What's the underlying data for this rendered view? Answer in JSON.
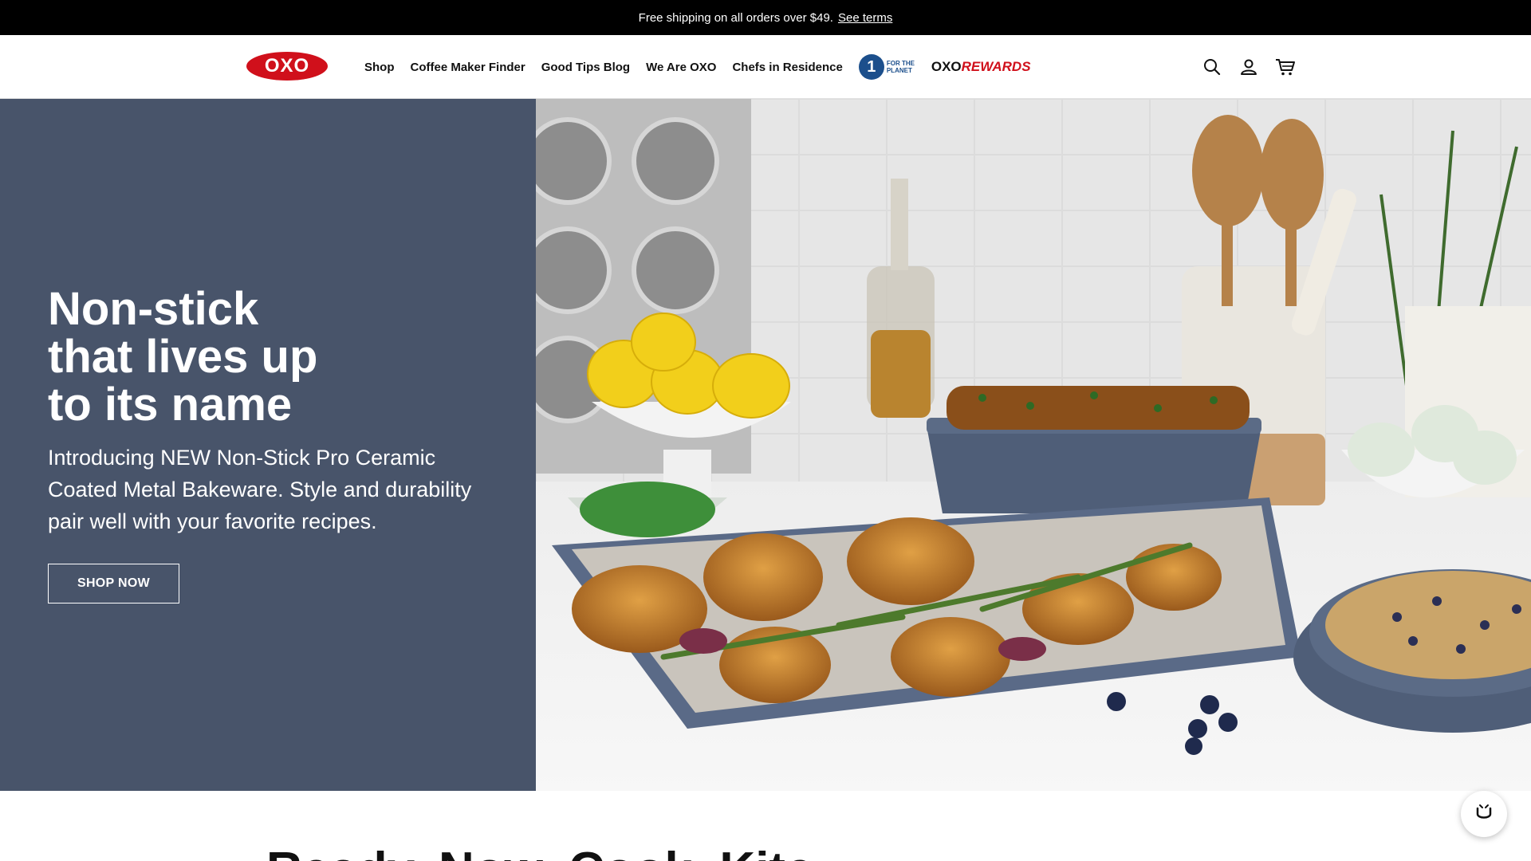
{
  "announcement": {
    "text": "Free shipping on all orders over $49.",
    "terms_link": "See terms"
  },
  "header": {
    "logo_text": "OXO",
    "nav": [
      {
        "label": "Shop"
      },
      {
        "label": "Coffee Maker Finder"
      },
      {
        "label": "Good Tips Blog"
      },
      {
        "label": "We Are OXO"
      },
      {
        "label": "Chefs in Residence"
      }
    ],
    "planet_badge": {
      "number": "1",
      "text": "FOR THE PLANET"
    },
    "rewards": {
      "brand": "OXO",
      "label": "REWARDS"
    },
    "icons": [
      "search-icon",
      "account-icon",
      "cart-icon"
    ]
  },
  "hero": {
    "title": "Non-stick\nthat lives up\nto its name",
    "subtitle": "Introducing NEW Non-Stick Pro Ceramic Coated Metal Bakeware. Style and durability pair well with your favorite recipes.",
    "cta": "SHOP NOW",
    "panel_color": "#48546a"
  },
  "below": {
    "heading": "Ready. Now. Cook. Kitc"
  },
  "colors": {
    "brand_red": "#d0101b",
    "announcement_bg": "#000000"
  }
}
